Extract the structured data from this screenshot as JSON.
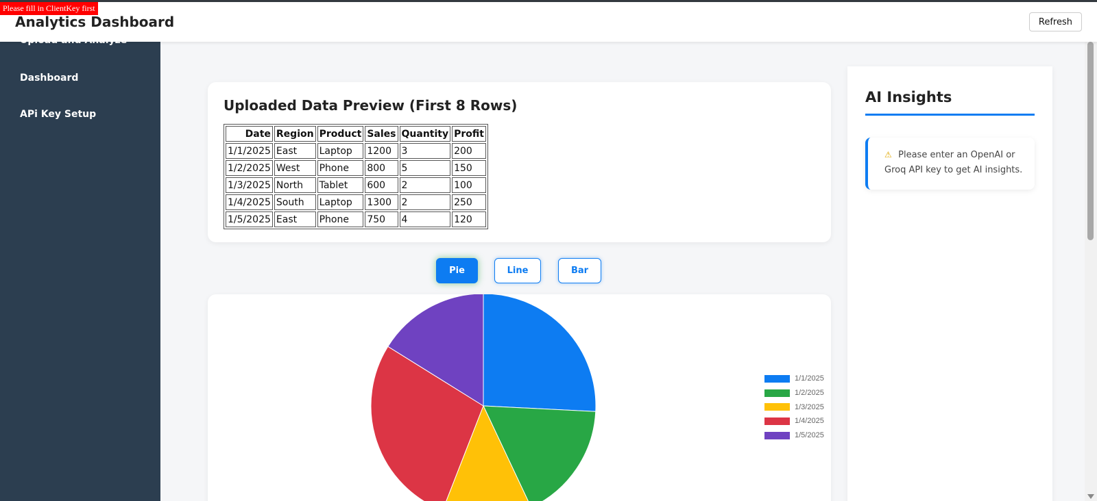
{
  "header": {
    "title": "Analytics Dashboard",
    "refresh_label": "Refresh",
    "client_alert": "Please fill in ClientKey first"
  },
  "sidebar": {
    "items": [
      {
        "label": "Upload and Analyze"
      },
      {
        "label": "Dashboard"
      },
      {
        "label": "APi Key Setup"
      }
    ]
  },
  "preview": {
    "title": "Uploaded Data Preview (First 8 Rows)",
    "columns": [
      "Date",
      "Region",
      "Product",
      "Sales",
      "Quantity",
      "Profit"
    ],
    "rows": [
      [
        "1/1/2025",
        "East",
        "Laptop",
        "1200",
        "3",
        "200"
      ],
      [
        "1/2/2025",
        "West",
        "Phone",
        "800",
        "5",
        "150"
      ],
      [
        "1/3/2025",
        "North",
        "Tablet",
        "600",
        "2",
        "100"
      ],
      [
        "1/4/2025",
        "South",
        "Laptop",
        "1300",
        "2",
        "250"
      ],
      [
        "1/5/2025",
        "East",
        "Phone",
        "750",
        "4",
        "120"
      ]
    ]
  },
  "chart_controls": {
    "pie_label": "Pie",
    "line_label": "Line",
    "bar_label": "Bar",
    "active": "Pie"
  },
  "chart_data": {
    "type": "pie",
    "categories": [
      "1/1/2025",
      "1/2/2025",
      "1/3/2025",
      "1/4/2025",
      "1/5/2025"
    ],
    "values": [
      1200,
      800,
      600,
      1300,
      750
    ],
    "colors": [
      "#0d7cf2",
      "#28a745",
      "#ffc107",
      "#dc3545",
      "#6f42c1"
    ],
    "legend_position": "right"
  },
  "ai_insights": {
    "title": "AI Insights",
    "warning_icon": "warning-icon",
    "message": "Please enter an OpenAI or Groq API key to get AI insights."
  }
}
